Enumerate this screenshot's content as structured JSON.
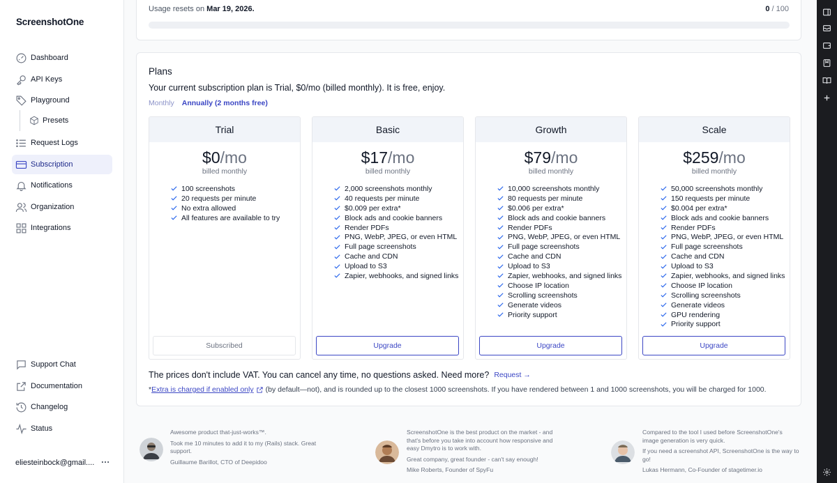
{
  "app": {
    "logo": "ScreenshotOne"
  },
  "sidebar": {
    "items": [
      {
        "label": "Dashboard",
        "icon": "gauge-icon"
      },
      {
        "label": "API Keys",
        "icon": "key-icon"
      },
      {
        "label": "Playground",
        "icon": "tag-icon"
      },
      {
        "label": "Presets",
        "icon": "cube-icon"
      },
      {
        "label": "Request Logs",
        "icon": "list-icon"
      },
      {
        "label": "Subscription",
        "icon": "credit-card-icon",
        "active": true
      },
      {
        "label": "Notifications",
        "icon": "bell-icon"
      },
      {
        "label": "Organization",
        "icon": "users-icon"
      },
      {
        "label": "Integrations",
        "icon": "puzzle-icon"
      }
    ],
    "bottom_items": [
      {
        "label": "Support Chat",
        "icon": "chat-icon"
      },
      {
        "label": "Documentation",
        "icon": "external-link-icon"
      },
      {
        "label": "Changelog",
        "icon": "history-icon"
      },
      {
        "label": "Status",
        "icon": "pulse-icon"
      }
    ],
    "user_email": "eliesteinbock@gmail....",
    "user_menu_icon": "ellipsis-icon"
  },
  "usage": {
    "prefix": "Usage resets on ",
    "date": "Mar 19, 2026.",
    "used": "0",
    "limit": " / 100",
    "progress_fraction": 0,
    "bar_color": "#4f46e5"
  },
  "plans": {
    "title": "Plans",
    "current": "Your current subscription plan is Trial, $0/mo (billed monthly). It is free, enjoy.",
    "toggle": {
      "monthly": "Monthly",
      "annual": "Annually (2 months free)"
    },
    "items": [
      {
        "name": "Trial",
        "price": "$0",
        "per": "/mo",
        "billed": "billed monthly",
        "features": [
          "100 screenshots",
          "20 requests per minute",
          "No extra allowed",
          "All features are available to try"
        ],
        "button": "Subscribed"
      },
      {
        "name": "Basic",
        "price": "$17",
        "per": "/mo",
        "billed": "billed monthly",
        "features": [
          "2,000 screenshots monthly",
          "40 requests per minute",
          "$0.009 per extra*",
          "Block ads and cookie banners",
          "Render PDFs",
          "PNG, WebP, JPEG, or even HTML",
          "Full page screenshots",
          "Cache and CDN",
          "Upload to S3",
          "Zapier, webhooks, and signed links"
        ],
        "button": "Upgrade"
      },
      {
        "name": "Growth",
        "price": "$79",
        "per": "/mo",
        "billed": "billed monthly",
        "features": [
          "10,000 screenshots monthly",
          "80 requests per minute",
          "$0.006 per extra*",
          "Block ads and cookie banners",
          "Render PDFs",
          "PNG, WebP, JPEG, or even HTML",
          "Full page screenshots",
          "Cache and CDN",
          "Upload to S3",
          "Zapier, webhooks, and signed links",
          "Choose IP location",
          "Scrolling screenshots",
          "Generate videos",
          "Priority support"
        ],
        "button": "Upgrade"
      },
      {
        "name": "Scale",
        "price": "$259",
        "per": "/mo",
        "billed": "billed monthly",
        "features": [
          "50,000 screenshots monthly",
          "150 requests per minute",
          "$0.004 per extra*",
          "Block ads and cookie banners",
          "Render PDFs",
          "PNG, WebP, JPEG, or even HTML",
          "Full page screenshots",
          "Cache and CDN",
          "Upload to S3",
          "Zapier, webhooks, and signed links",
          "Choose IP location",
          "Scrolling screenshots",
          "Generate videos",
          "GPU rendering",
          "Priority support"
        ],
        "button": "Upgrade"
      }
    ],
    "vat_text": "The prices don't include VAT. You can cancel any time, no questions asked. Need more?",
    "vat_request": "Request →",
    "extra_star": "*",
    "extra_link": "Extra is charged if enabled only",
    "extra_rest": "(by default—not), and is rounded up to the closest 1000 screenshots. If you have rendered between 1 and 1000 screenshots, you will be charged for 1000."
  },
  "testimonials": [
    {
      "lines": [
        "Awesome product that-just-works™.",
        "Took me 10 minutes to add it to my (Rails) stack. Great support."
      ],
      "author": "Guillaume Barillot, CTO of Deepidoo"
    },
    {
      "lines": [
        "ScreenshotOne is the best product on the market - and that's before you take into account how responsive and easy Dmytro is to work with.",
        "Great company, great founder - can't say enough!"
      ],
      "author": "Mike Roberts, Founder of SpyFu"
    },
    {
      "lines": [
        "Compared to the tool I used before ScreenshotOne's image generation is very quick.",
        "If you need a screenshot API, ScreenshotOne is the way to go!"
      ],
      "author": "Lukas Hermann, Co-Founder of stagetimer.io"
    }
  ],
  "rail_icons": [
    "sidebar-toggle-icon",
    "inbox-icon",
    "wallet-icon",
    "bookmark-icon",
    "book-icon",
    "plus-icon",
    "settings-icon"
  ],
  "colors": {
    "accent": "#3b46c4",
    "check": "#2563eb",
    "rail": "#1b1c20"
  }
}
